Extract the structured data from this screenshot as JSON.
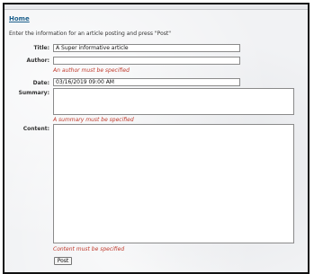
{
  "nav": {
    "home_label": "Home"
  },
  "intro_text": "Enter the information for an article posting and press \"Post\"",
  "form": {
    "title": {
      "label": "Title:",
      "value": "A Super informative article"
    },
    "author": {
      "label": "Author:",
      "value": "",
      "error": "An author must be specified"
    },
    "date": {
      "label": "Date:",
      "value": "03/16/2019 09:00 AM"
    },
    "summary": {
      "label": "Summary:",
      "value": "",
      "error": "A summary must be specified"
    },
    "content": {
      "label": "Content:",
      "value": "",
      "error": "Content must be specified"
    },
    "submit_label": "Post"
  },
  "colors": {
    "error": "#c0392b",
    "link": "#1c5f8c"
  }
}
